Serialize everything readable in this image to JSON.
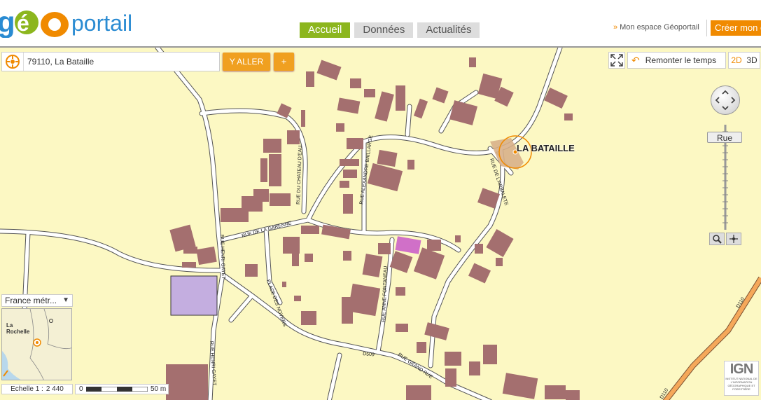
{
  "header": {
    "logo": {
      "part1": "g",
      "part2": "é",
      "part3": "O",
      "part4": "portail",
      "colors": {
        "green": "#8cb61e",
        "orange": "#f08a00",
        "blue": "#2a8bd2"
      }
    },
    "tabs": [
      {
        "label": "Accueil",
        "active": true
      },
      {
        "label": "Données",
        "active": false
      },
      {
        "label": "Actualités",
        "active": false
      }
    ],
    "my_space": "Mon espace Géoportail",
    "create_account": "Créer mon compte"
  },
  "search": {
    "icon": "geoportail-locate-icon",
    "value": "79110, La Bataille",
    "go_label": "Y ALLER",
    "plus_label": "+"
  },
  "toolbar": {
    "fullscreen_icon": "fullscreen-icon",
    "time_label": "Remonter le temps",
    "time_icon": "undo-arrow-icon",
    "mode_2d": "2D",
    "mode_3d": "3D"
  },
  "navigation": {
    "pan_icon": "pan-arrows-icon",
    "zoom_level_label": "Rue",
    "zoom_box_icon": "magnifier-icon",
    "zoom_center_icon": "crosshair-icon"
  },
  "territory_select": {
    "value": "France métr..."
  },
  "minimap": {
    "labels": [
      "La",
      "Rochelle"
    ]
  },
  "scale": {
    "label": "Echelle 1 :",
    "value": "2 440",
    "ruler_start": "0",
    "ruler_end": "50 m"
  },
  "ign": {
    "logo_text": "IGN",
    "subtitle": "INSTITUT NATIONAL DE L'INFORMATION GÉOGRAPHIQUE ET FORESTIÈRE"
  },
  "map": {
    "place_name": "LA BATAILLE",
    "streets": [
      "RUE DU CHATEAU D'EAU",
      "RUE ALEXANDRE BAILLARGE",
      "RUE DE L'ARBALETE",
      "RUE DE LA GARENNE",
      "RUE HENRI GAYET",
      "RUE HENRI GAYET",
      "PLACE DES NOYERS",
      "RUE ANNE FONTANEAU",
      "D509",
      "RUE GRAND RUE",
      "D110",
      "D110"
    ],
    "colors": {
      "background": "#fcf8c3",
      "building": "#a46f6f",
      "special_building": "#d070c8",
      "parcel": "#c4aee0",
      "road": "#ffffff",
      "road_casing": "#555555",
      "primary_road": "#f5a85a"
    }
  }
}
